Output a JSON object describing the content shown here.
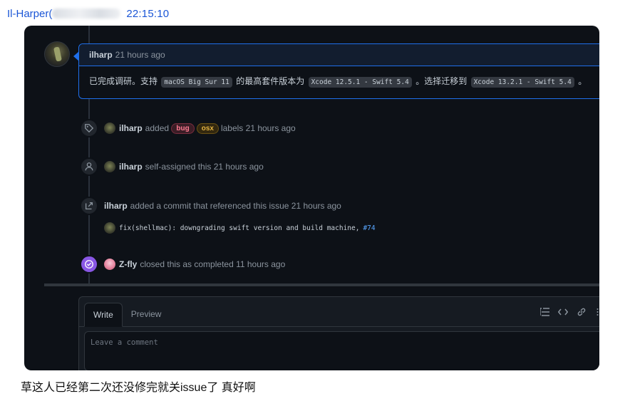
{
  "chat": {
    "sender": "Il-Harper(",
    "time": "22:15:10",
    "caption": "草这人已经第二次还没修完就关issue了  真好啊"
  },
  "comment": {
    "author": "ilharp",
    "time": "21 hours ago",
    "body": {
      "text_1": "已完成调研。支持",
      "code_1": "macOS Big Sur 11",
      "text_2": "的最高套件版本为",
      "code_2": "Xcode 12.5.1 - Swift 5.4",
      "text_3": "。选择迁移到",
      "code_3": "Xcode 13.2.1 - Swift 5.4",
      "text_4": "。"
    }
  },
  "events": [
    {
      "icon": "tag-icon",
      "actor": "ilharp",
      "text": "added",
      "labels": [
        "bug",
        "osx"
      ],
      "suffix": "labels 21 hours ago"
    },
    {
      "icon": "person-icon",
      "actor": "ilharp",
      "text": "self-assigned this 21 hours ago"
    },
    {
      "icon": "cross-reference-icon",
      "actor": "ilharp",
      "text": "added a commit that referenced this issue 21 hours ago"
    },
    {
      "icon": "check-circle-icon",
      "actor": "Z-fly",
      "text": "closed this as completed 11 hours ago"
    }
  ],
  "commit": {
    "message": "fix(shellmac): downgrading swift version and build machine,",
    "ref": "#74"
  },
  "editor": {
    "tabs": [
      "Write",
      "Preview"
    ],
    "active_tab": "Write",
    "placeholder": "Leave a comment",
    "toolbar": [
      "heading-icon",
      "code-icon",
      "link-icon",
      "list-icon"
    ]
  },
  "colors": {
    "accent": "#1f6feb",
    "closed": "#8957e5",
    "link": "#58a6ff",
    "background": "#0d1117"
  }
}
